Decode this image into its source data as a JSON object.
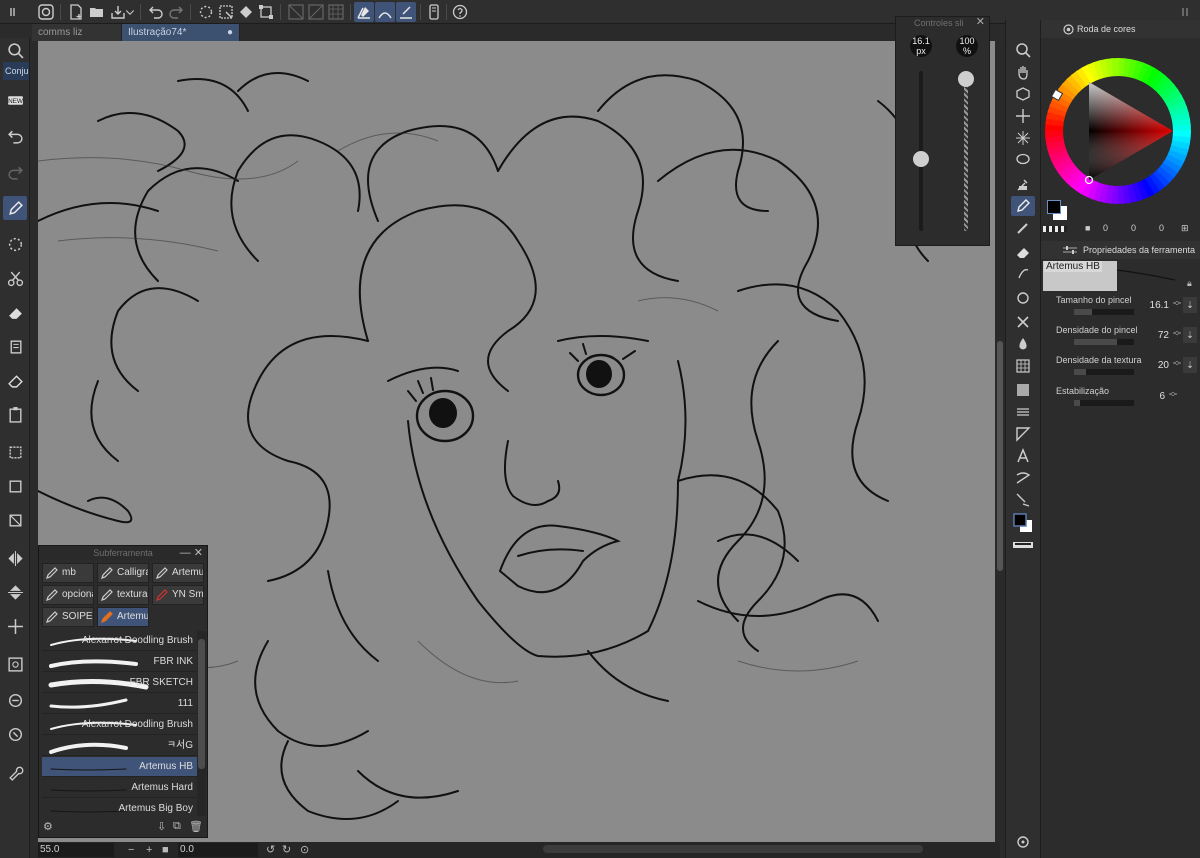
{
  "tabs": [
    {
      "label": "comms liz",
      "active": false
    },
    {
      "label": "Ilustração74*",
      "active": true,
      "modified_marker": "●"
    }
  ],
  "left_toolbar": {
    "active_label": "Conju"
  },
  "controller": {
    "title": "Controles sli",
    "size_value": "16.1",
    "size_unit": "px",
    "opacity_value": "100",
    "opacity_unit": "%",
    "size_level": 0.45,
    "opacity_level": 1.0
  },
  "color_panel": {
    "title": "Roda de cores",
    "readout": [
      "0",
      "0",
      "0"
    ],
    "main_color": "#000000",
    "sub_color": "#ffffff"
  },
  "tool_properties": {
    "title": "Propriedades da ferramenta",
    "preset_name": "Artemus HB",
    "props": [
      {
        "label": "Tamanho do pincel",
        "value": "16.1",
        "level": 0.3
      },
      {
        "label": "Densidade do pincel",
        "value": "72",
        "level": 0.72
      },
      {
        "label": "Densidade da textura",
        "value": "20",
        "level": 0.2
      },
      {
        "label": "Estabilização",
        "value": "6",
        "level": 0.1
      }
    ]
  },
  "subtool": {
    "title": "Subferramenta",
    "groups": [
      {
        "label": "mb",
        "selected": false
      },
      {
        "label": "Calligra",
        "selected": false
      },
      {
        "label": "Artemu",
        "selected": false
      },
      {
        "label": "opciona",
        "selected": false
      },
      {
        "label": "textura",
        "selected": false
      },
      {
        "label": "YN Sm",
        "selected": false
      },
      {
        "label": "SOIPEI",
        "selected": false
      },
      {
        "label": "Artemu",
        "selected": true
      }
    ],
    "brushes": [
      {
        "label": "Alexarrot Doodling Brush",
        "selected": false
      },
      {
        "label": "FBR INK",
        "selected": false
      },
      {
        "label": "FBR SKETCH",
        "selected": false
      },
      {
        "label": "111",
        "selected": false
      },
      {
        "label": "Alexarrot Doodling Brush",
        "selected": false
      },
      {
        "label": "ㅋ서G",
        "selected": false
      },
      {
        "label": "Artemus HB",
        "selected": true
      },
      {
        "label": "Artemus Hard",
        "selected": false
      },
      {
        "label": "Artemus Big Boy",
        "selected": false
      }
    ]
  },
  "status": {
    "zoom": "55.0",
    "zoom_minus": "−",
    "zoom_plus": "+",
    "angle": "0.0"
  },
  "colors": {
    "accent": "#3f5478",
    "canvas_bg": "#8b8b8b",
    "panel_bg": "#2c2c2c"
  }
}
